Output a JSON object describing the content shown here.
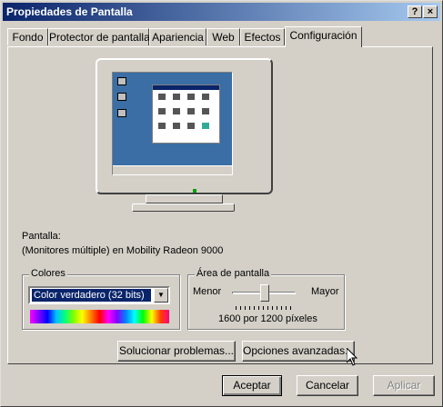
{
  "window": {
    "title": "Propiedades de Pantalla",
    "help_btn": "?",
    "close_btn": "×"
  },
  "tabs": [
    "Fondo",
    "Protector de pantalla",
    "Apariencia",
    "Web",
    "Efectos",
    "Configuración"
  ],
  "active_tab": "Configuración",
  "display": {
    "label": "Pantalla:",
    "monitor_name": "(Monitores múltiple) en Mobility Radeon 9000"
  },
  "colors": {
    "group_label": "Colores",
    "selected": "Color verdadero (32 bits)"
  },
  "screen_area": {
    "group_label": "Área de pantalla",
    "min_label": "Menor",
    "max_label": "Mayor",
    "resolution": "1600 por 1200 píxeles",
    "slider_position": 0.5
  },
  "buttons": {
    "troubleshoot": "Solucionar problemas...",
    "advanced": "Opciones avanzadas...",
    "ok": "Aceptar",
    "cancel": "Cancelar",
    "apply": "Aplicar"
  },
  "colors_theme": {
    "title_start": "#0a246a",
    "title_end": "#a6caf0",
    "desktop": "#3a6ea5",
    "face": "#d4d0c8"
  }
}
